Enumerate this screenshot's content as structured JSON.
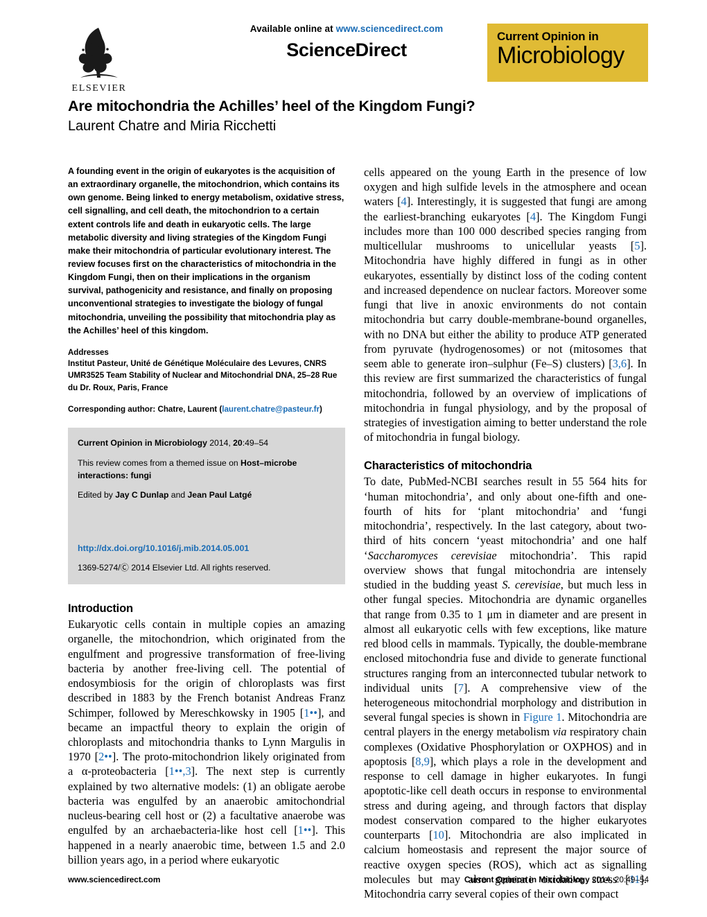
{
  "masthead": {
    "available_prefix": "Available online at ",
    "available_url": "www.sciencedirect.com",
    "wordmark": "ScienceDirect",
    "publisher_name": "ELSEVIER",
    "journal_logo_top": "Current Opinion in",
    "journal_logo_bottom": "Microbiology",
    "journal_logo_color": "#e0bb35",
    "link_color": "#1a6cb5"
  },
  "article": {
    "title": "Are mitochondria the Achilles’ heel of the Kingdom Fungi?",
    "authors": "Laurent Chatre and Miria Ricchetti"
  },
  "abstract": {
    "text": "A founding event in the origin of eukaryotes is the acquisition of an extraordinary organelle, the mitochondrion, which contains its own genome. Being linked to energy metabolism, oxidative stress, cell signalling, and cell death, the mitochondrion to a certain extent controls life and death in eukaryotic cells. The large metabolic diversity and living strategies of the Kingdom Fungi make their mitochondria of particular evolutionary interest. The review focuses first on the characteristics of mitochondria in the Kingdom Fungi, then on their implications in the organism survival, pathogenicity and resistance, and finally on proposing unconventional strategies to investigate the biology of fungal mitochondria, unveiling the possibility that mitochondria play as the Achilles’ heel of this kingdom."
  },
  "addresses": {
    "heading": "Addresses",
    "body": "Institut Pasteur, Unité de Génétique Moléculaire des Levures, CNRS UMR3525 Team Stability of Nuclear and Mitochondrial DNA, 25–28 Rue du Dr. Roux, Paris, France",
    "corresponding_prefix": "Corresponding author: Chatre, Laurent (",
    "corresponding_email": "laurent.chatre@pasteur.fr",
    "corresponding_suffix": ")"
  },
  "citation_box": {
    "journal_name": "Current Opinion in Microbiology",
    "journal_year_volume_prefix": " 2014, ",
    "volume": "20",
    "pages": ":49–54",
    "themed_prefix": "This review comes from a themed issue on ",
    "themed_issue": "Host–microbe interactions: fungi",
    "edited_prefix": "Edited by ",
    "editor_one": "Jay C Dunlap",
    "edited_joiner": " and ",
    "editor_two": "Jean Paul Latgé",
    "doi": "http://dx.doi.org/10.1016/j.mib.2014.05.001",
    "copyright": "1369-5274/Ⓒ 2014 Elsevier Ltd. All rights reserved.",
    "background_color": "#d7d7d7"
  },
  "sections": {
    "introduction_heading": "Introduction",
    "characteristics_heading": "Characteristics of mitochondria"
  },
  "body": {
    "intro_p1_a": "Eukaryotic cells contain in multiple copies an amazing organelle, the mitochondrion, which originated from the engulfment and progressive transformation of free-living bacteria by another free-living cell. The potential of endosymbiosis for the origin of chloroplasts was first described in 1883 by the French botanist Andreas Franz Schimper, followed by Mereschkowsky in 1905 [",
    "ref_1a": "1••",
    "intro_p1_b": "], and became an impactful theory to explain the origin of chloroplasts and mitochondria thanks to Lynn Margulis in 1970 [",
    "ref_2": "2••",
    "intro_p1_c": "]. The proto-mitochondrion likely originated from a α-proteobacteria [",
    "ref_1b": "1••,3",
    "intro_p1_d": "]. The next step is currently explained by two alternative models: (1) an obligate aerobe bacteria was engulfed by an anaerobic amitochondrial nucleus-bearing cell host or (2) a facultative anaerobe was engulfed by an archaebacteria-like host cell [",
    "ref_1c": "1••",
    "intro_p1_e": "]. This happened in a nearly anaerobic time, between 1.5 and 2.0 billion years ago, in a period where eukaryotic",
    "right_p1_a": "cells appeared on the young Earth in the presence of low oxygen and high sulfide levels in the atmosphere and ocean waters [",
    "ref_4a": "4",
    "right_p1_b": "]. Interestingly, it is suggested that fungi are among the earliest-branching eukaryotes [",
    "ref_4b": "4",
    "right_p1_c": "]. The Kingdom Fungi includes more than 100 000 described species ranging from multicellular mushrooms to unicellular yeasts [",
    "ref_5": "5",
    "right_p1_d": "]. Mitochondria have highly differed in fungi as in other eukaryotes, essentially by distinct loss of the coding content and increased dependence on nuclear factors. Moreover some fungi that live in anoxic environments do not contain mitochondria but carry double-membrane-bound organelles, with no DNA but either the ability to produce ATP generated from pyruvate (hydrogenosomes) or not (mitosomes that seem able to generate iron–sulphur (Fe–S) clusters) [",
    "ref_36": "3,6",
    "right_p1_e": "]. In this review are first summarized the characteristics of fungal mitochondria, followed by an overview of implications of mitochondria in fungal physiology, and by the proposal of strategies of investigation aiming to better understand the role of mitochondria in fungal biology.",
    "char_p1_a": "To date, PubMed-NCBI searches result in 55 564 hits for ‘human mitochondria’, and only about one-fifth and one-fourth of hits for ‘plant mitochondria’ and ‘fungi mitochondria’, respectively. In the last category, about two-third of hits concern ‘yeast mitochondria’ and one half ‘",
    "sacch_italic": "Saccharomyces cerevisiae",
    "char_p1_b": " mitochondria’. This rapid overview shows that fungal mitochondria are intensely studied in the budding yeast ",
    "scer_italic": "S. cerevisiae",
    "char_p1_c": ", but much less in other fungal species. Mitochondria are dynamic organelles that range from 0.35 to 1 μm in diameter and are present in almost all eukaryotic cells with few exceptions, like mature red blood cells in mammals. Typically, the double-membrane enclosed mitochondria fuse and divide to generate functional structures ranging from an interconnected tubular network to individual units [",
    "ref_7": "7",
    "char_p1_d": "]. A comprehensive view of the heterogeneous mitochondrial morphology and distribution in several fungal species is shown in ",
    "figure_link": "Figure 1",
    "char_p1_e": ". Mitochondria are central players in the energy metabolism ",
    "via_italic": "via",
    "char_p1_f": " respiratory chain complexes (Oxidative Phosphorylation or OXPHOS) and in apoptosis [",
    "ref_89": "8,9",
    "char_p1_g": "], which plays a role in the development and response to cell damage in higher eukaryotes. In fungi apoptotic-like cell death occurs in response to environmental stress and during ageing, and through factors that display modest conservation compared to the higher eukaryotes counterparts [",
    "ref_10": "10",
    "char_p1_h": "]. Mitochondria are also implicated in calcium homeostasis and represent the major source of reactive oxygen species (ROS), which act as signalling molecules but may also generate oxidative stress [",
    "ref_11": "11",
    "char_p1_i": "]. Mitochondria carry several copies of their own compact"
  },
  "footer": {
    "left": "www.sciencedirect.com",
    "right_journal": "Current Opinion in Microbiology",
    "right_rest": " 2014, 20:49–54"
  }
}
